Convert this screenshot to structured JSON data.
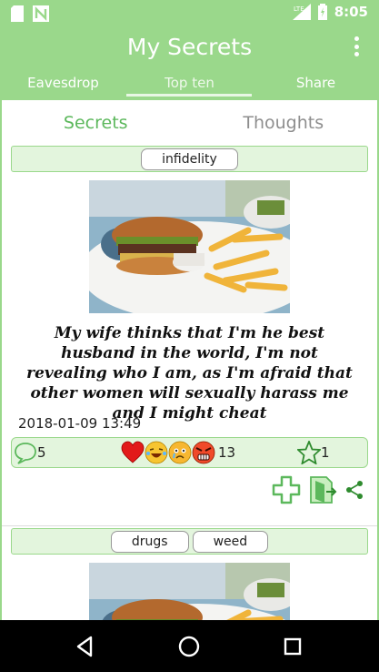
{
  "status_bar": {
    "time": "8:05",
    "network": "LTE"
  },
  "app_bar": {
    "title": "My Secrets"
  },
  "tabs": [
    {
      "label": "Eavesdrop"
    },
    {
      "label": "Top ten"
    },
    {
      "label": "Share"
    }
  ],
  "sub_tabs": [
    {
      "label": "Secrets"
    },
    {
      "label": "Thoughts"
    }
  ],
  "posts": [
    {
      "tags": [
        "infidelity"
      ],
      "text": "My wife thinks that I'm he best husband in the world, I'm not revealing who I am, as I'm afraid that other women will sexually harass me and I might cheat",
      "date": "2018-01-09 13:49",
      "comments": "5",
      "reactions": "13",
      "stars": "1"
    },
    {
      "tags": [
        "drugs",
        "weed"
      ]
    }
  ],
  "colors": {
    "primary": "#9ad88b",
    "accent": "#5cb85c",
    "tag_bg": "#e3f5dd"
  }
}
